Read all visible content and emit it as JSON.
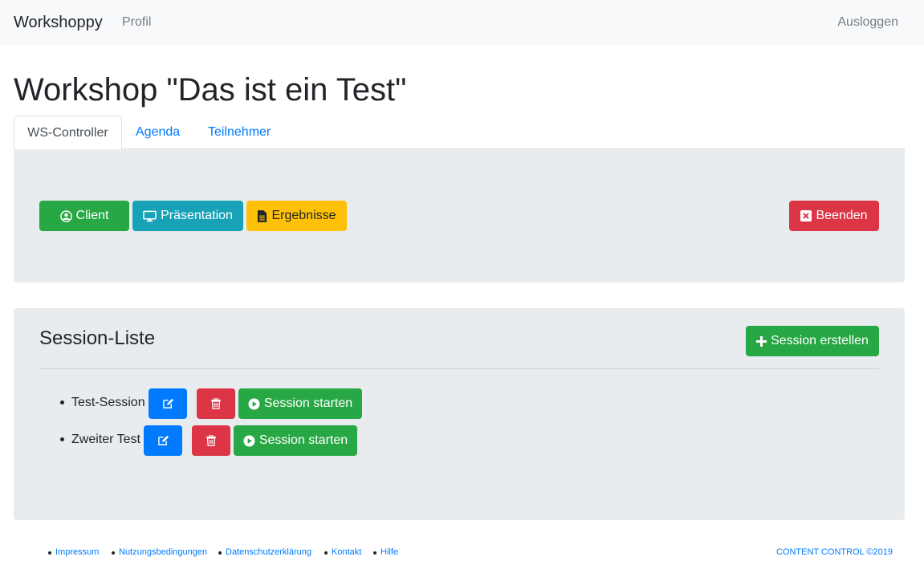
{
  "navbar": {
    "brand": "Workshoppy",
    "profile_label": "Profil",
    "logout_label": "Ausloggen"
  },
  "page": {
    "title": "Workshop \"Das ist ein Test\""
  },
  "tabs": [
    {
      "label": "WS-Controller",
      "active": true
    },
    {
      "label": "Agenda",
      "active": false
    },
    {
      "label": "Teilnehmer",
      "active": false
    }
  ],
  "controller": {
    "client_label": "Client",
    "presentation_label": "Präsentation",
    "results_label": "Ergebnisse",
    "end_label": "Beenden"
  },
  "sessions": {
    "title": "Session-Liste",
    "create_label": "Session erstellen",
    "items": [
      {
        "name": "Test-Session",
        "start_label": "Session starten"
      },
      {
        "name": "Zweiter Test",
        "start_label": "Session starten"
      }
    ]
  },
  "footer": {
    "links": [
      "Impressum",
      "Nutzungsbedingungen",
      "Datenschutzerklärung",
      "Kontakt",
      "Hilfe"
    ],
    "copyright": "CONTENT CONTROL ©2019"
  },
  "colors": {
    "primary": "#007bff",
    "success": "#28a745",
    "info": "#17a2b8",
    "warning": "#ffc107",
    "danger": "#dc3545",
    "panel": "#e9ecef"
  }
}
